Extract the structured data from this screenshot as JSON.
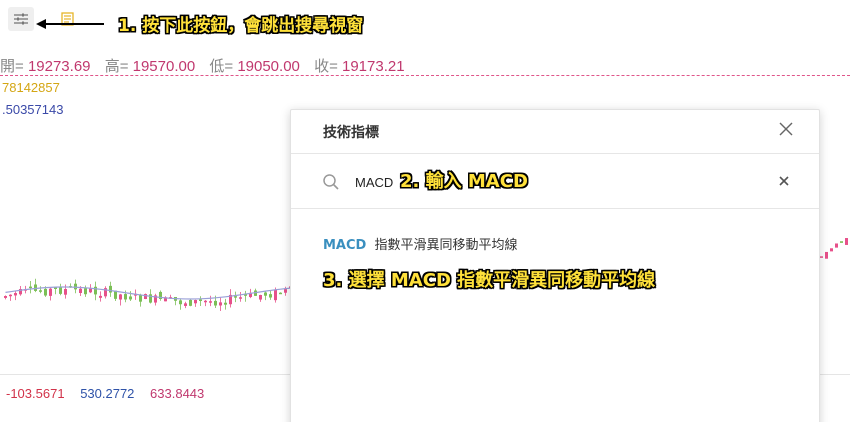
{
  "toolbar": {
    "settings_icon": "sliders-icon",
    "alt_icon": "template-icon"
  },
  "annotations": {
    "step1": "1. 按下此按鈕，會跳出搜尋視窗",
    "step2": "2. 輸入 MACD",
    "step3": "3. 選擇 MACD 指數平滑異同移動平均線"
  },
  "ohlc": {
    "open_label": "開=",
    "open_value": "19273.69",
    "high_label": "高=",
    "high_value": "19570.00",
    "low_label": "低=",
    "low_value": "19050.00",
    "close_label": "收=",
    "close_value": "19173.21"
  },
  "indicators": {
    "line1_value": "78142857",
    "line2_value": ".50357143"
  },
  "macd_values": [
    "-103.5671",
    "530.2772",
    "633.8443"
  ],
  "modal": {
    "title": "技術指標",
    "search_value": "MACD",
    "result_name": "MACD",
    "result_desc": "指數平滑異同移動平均線"
  },
  "colors": {
    "up": "#e7508a",
    "down": "#7bbf56",
    "ma": "#9aa0d8"
  }
}
